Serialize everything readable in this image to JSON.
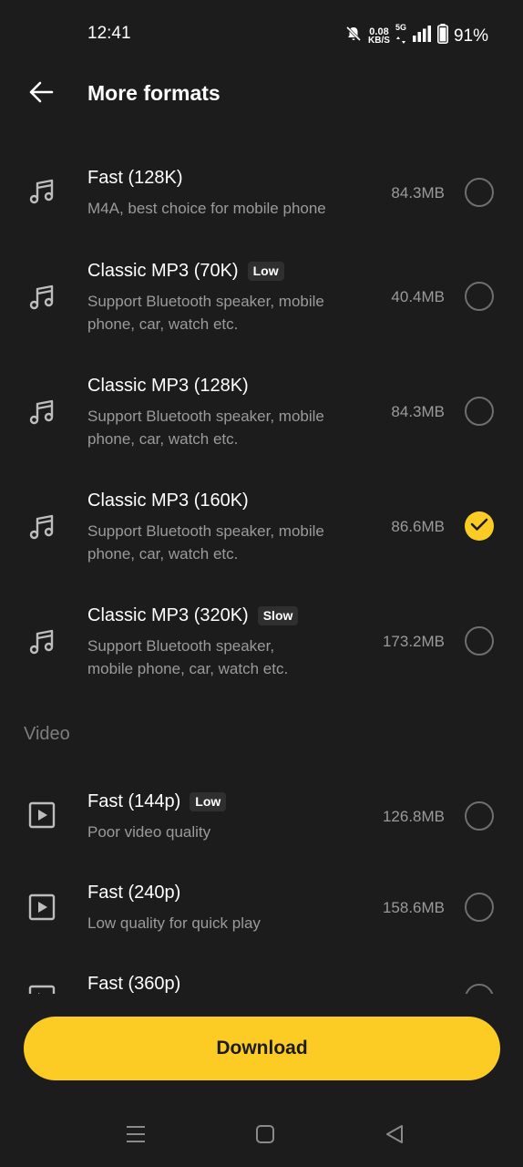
{
  "status_bar": {
    "time": "12:41",
    "speed_value": "0.08",
    "speed_unit": "KB/S",
    "network": "5G",
    "battery": "91%"
  },
  "header": {
    "title": "More formats"
  },
  "audio_items": [
    {
      "title": "Fast (128K)",
      "badge": "",
      "subtitle_line1": "M4A, best choice for mobile phone",
      "subtitle_line2": "",
      "size": "84.3MB",
      "selected": false
    },
    {
      "title": "Classic MP3 (70K)",
      "badge": "Low",
      "subtitle_line1": "Support Bluetooth speaker, mobile",
      "subtitle_line2": "phone, car, watch etc.",
      "size": "40.4MB",
      "selected": false
    },
    {
      "title": "Classic MP3 (128K)",
      "badge": "",
      "subtitle_line1": "Support Bluetooth speaker, mobile",
      "subtitle_line2": "phone, car, watch etc.",
      "size": "84.3MB",
      "selected": false
    },
    {
      "title": "Classic MP3 (160K)",
      "badge": "",
      "subtitle_line1": "Support Bluetooth speaker, mobile",
      "subtitle_line2": "phone, car, watch etc.",
      "size": "86.6MB",
      "selected": true
    },
    {
      "title": "Classic MP3 (320K)",
      "badge": "Slow",
      "subtitle_line1": "Support Bluetooth speaker,",
      "subtitle_line2": "mobile phone, car, watch etc.",
      "size": "173.2MB",
      "selected": false
    }
  ],
  "video_section_label": "Video",
  "video_items": [
    {
      "title": "Fast (144p)",
      "badge": "Low",
      "subtitle_line1": "Poor video quality",
      "size": "126.8MB",
      "selected": false
    },
    {
      "title": "Fast (240p)",
      "badge": "",
      "subtitle_line1": "Low quality for quick play",
      "size": "158.6MB",
      "selected": false
    },
    {
      "title": "Fast (360p)",
      "badge": "",
      "subtitle_line1": "",
      "size": "",
      "selected": false
    }
  ],
  "download_label": "Download",
  "colors": {
    "accent": "#fccb24",
    "background": "#1c1c1c",
    "secondary_text": "#9a9a9a"
  },
  "icons": {
    "back": "arrow-left-icon",
    "audio": "music-note-icon",
    "video": "play-box-icon",
    "check": "check-icon"
  }
}
